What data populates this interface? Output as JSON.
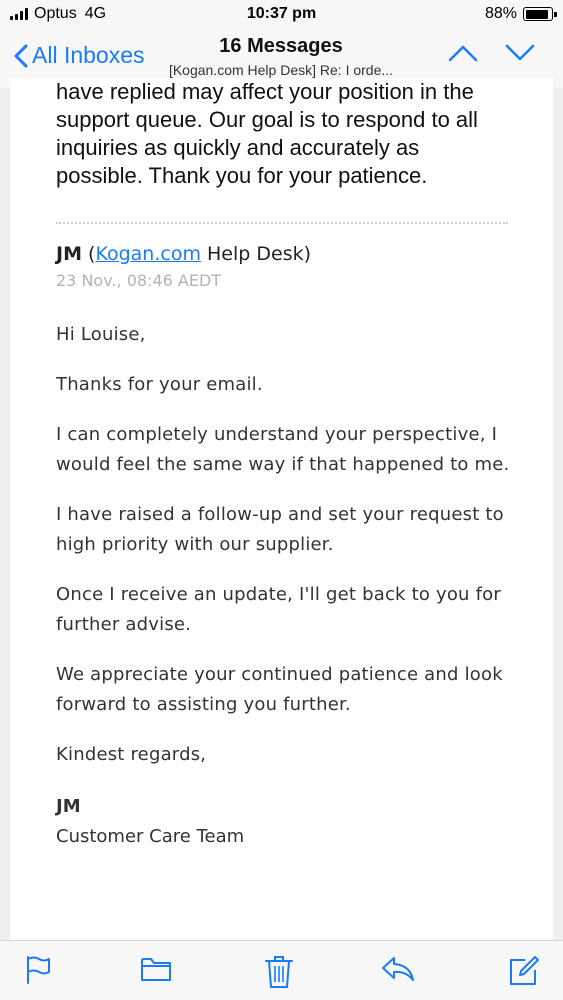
{
  "status_bar": {
    "carrier": "Optus",
    "network": "4G",
    "time": "10:37 pm",
    "battery_text": "88%",
    "battery_level": 0.88
  },
  "nav": {
    "back_label": "All Inboxes",
    "title": "16 Messages",
    "subtitle": "[Kogan.com Help Desk] Re: I orde..."
  },
  "previous_message": {
    "lines": [
      "have replied may affect your position in the",
      "support queue. Our goal is to respond to all",
      "inquiries as quickly and accurately as",
      "possible. Thank you for your patience."
    ]
  },
  "message": {
    "sender_initials": "JM",
    "open_paren": "(",
    "sender_link": "Kogan.com",
    "sender_rest": "Help Desk)",
    "date": "23 Nov., 08:46 AEDT",
    "paragraphs": [
      "Hi Louise,",
      "Thanks for your email.",
      "I can completely understand your perspective, I would feel the same way if that happened to me.",
      "I have raised a follow-up and set your request to high priority with our supplier.",
      "Once I receive an update, I'll get back to you for further advise.",
      "We appreciate your continued patience and look forward to assisting you further.",
      "Kindest regards,"
    ],
    "signature_name": "JM",
    "signature_team": "Customer Care Team"
  },
  "toolbar": {
    "icons": [
      "flag-icon",
      "folder-icon",
      "trash-icon",
      "reply-icon",
      "compose-icon"
    ]
  },
  "colors": {
    "accent": "#1a7cf5",
    "date_grey": "#b3b3b3",
    "background": "#efefef"
  }
}
